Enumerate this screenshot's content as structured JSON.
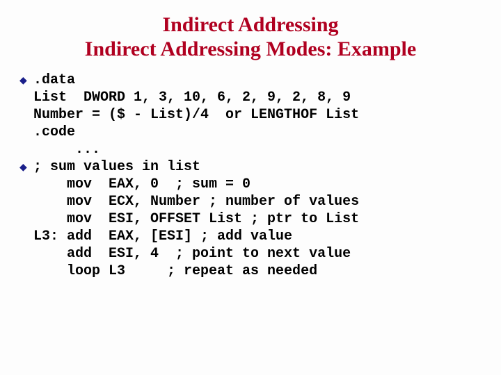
{
  "title": {
    "line1": "Indirect Addressing",
    "line2": "Indirect Addressing Modes:  Example"
  },
  "bullets": [
    {
      "code": ".data\nList  DWORD 1, 3, 10, 6, 2, 9, 2, 8, 9\nNumber = ($ - List)/4  or LENGTHOF List\n.code\n     ...                                     "
    },
    {
      "code": "; sum values in list\n    mov  EAX, 0  ; sum = 0\n    mov  ECX, Number ; number of values\n    mov  ESI, OFFSET List ; ptr to List\nL3: add  EAX, [ESI] ; add value\n    add  ESI, 4  ; point to next value\n    loop L3     ; repeat as needed"
    }
  ]
}
